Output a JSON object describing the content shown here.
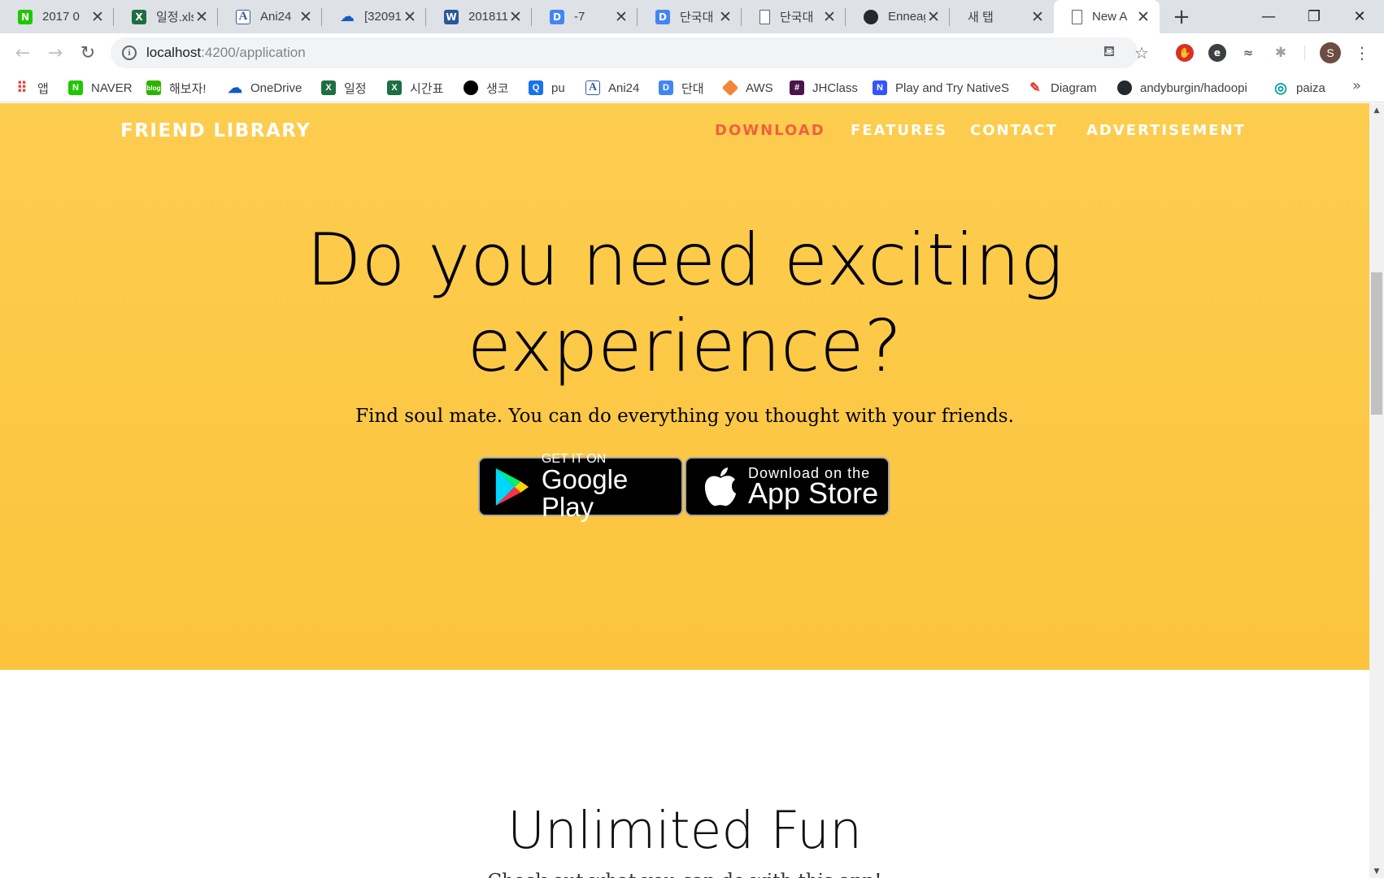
{
  "browser": {
    "tabs": [
      {
        "title": "2017 0",
        "icon": "naver-icon",
        "color": "#1ec800",
        "glyph": "N"
      },
      {
        "title": "일정.xls",
        "icon": "excel-icon",
        "color": "#1d6f42",
        "glyph": "X"
      },
      {
        "title": "Ani24",
        "icon": "ani24-icon",
        "color": "#3a5ba0",
        "glyph": "A"
      },
      {
        "title": "[32091",
        "icon": "onedrive-icon",
        "color": "#0f5bc2",
        "glyph": "☁"
      },
      {
        "title": "201811",
        "icon": "word-icon",
        "color": "#2b579a",
        "glyph": "W"
      },
      {
        "title": "-7",
        "icon": "daum-d-icon",
        "color": "#4285f4",
        "glyph": "D"
      },
      {
        "title": "단국대",
        "icon": "daum-d-icon",
        "color": "#4285f4",
        "glyph": "D"
      },
      {
        "title": "단국대",
        "icon": "document-icon",
        "color": "#ffffff",
        "glyph": ""
      },
      {
        "title": "Enneag",
        "icon": "github-icon",
        "color": "#24292e",
        "glyph": "●"
      },
      {
        "title": "새 탭",
        "icon": "",
        "color": "",
        "glyph": ""
      },
      {
        "title": "New A",
        "icon": "document-icon",
        "color": "#ffffff",
        "glyph": ""
      }
    ],
    "address": {
      "host": "localhost",
      "path": ":4200/application"
    },
    "profile_initial": "S",
    "bookmarks": [
      {
        "label": "앱",
        "icon": "apps-grid-icon",
        "color": "#ea4335",
        "glyph": "⋮"
      },
      {
        "label": "NAVER",
        "icon": "naver-icon",
        "color": "#1ec800",
        "glyph": "N"
      },
      {
        "label": "해보자!",
        "icon": "blog-icon",
        "color": "#2db400",
        "glyph": "b"
      },
      {
        "label": "OneDrive",
        "icon": "onedrive-icon",
        "color": "#0f5bc2",
        "glyph": "☁"
      },
      {
        "label": "일정",
        "icon": "excel-icon",
        "color": "#1d6f42",
        "glyph": "X"
      },
      {
        "label": "시간표",
        "icon": "excel-icon",
        "color": "#1d6f42",
        "glyph": "X"
      },
      {
        "label": "생코",
        "icon": "circle-icon",
        "color": "#000000",
        "glyph": ""
      },
      {
        "label": "pu",
        "icon": "blue-square-icon",
        "color": "#1a73e8",
        "glyph": "Q"
      },
      {
        "label": "Ani24",
        "icon": "ani24-icon",
        "color": "#3a5ba0",
        "glyph": "A"
      },
      {
        "label": "단대",
        "icon": "daum-d-icon",
        "color": "#4285f4",
        "glyph": "D"
      },
      {
        "label": "AWS",
        "icon": "aws-cube-icon",
        "color": "#f58536",
        "glyph": "◆"
      },
      {
        "label": "JHClass",
        "icon": "hash-icon",
        "color": "#4a154b",
        "glyph": "#"
      },
      {
        "label": "Play and Try NativeS",
        "icon": "nativescript-icon",
        "color": "#3655ff",
        "glyph": "N"
      },
      {
        "label": "Diagram",
        "icon": "diagram-icon",
        "color": "#e53935",
        "glyph": "✎"
      },
      {
        "label": "andyburgin/hadoopi",
        "icon": "github-icon",
        "color": "#24292e",
        "glyph": "●"
      },
      {
        "label": "paiza",
        "icon": "paiza-icon",
        "color": "#00a0a0",
        "glyph": "◎"
      }
    ]
  },
  "page": {
    "brand": "FRIEND LIBRARY",
    "nav": [
      {
        "label": "DOWNLOAD",
        "active": true
      },
      {
        "label": "FEATURES",
        "active": false
      },
      {
        "label": "CONTACT",
        "active": false
      },
      {
        "label": "ADVERTISEMENT",
        "active": false
      }
    ],
    "hero": {
      "headline_line1": "Do you need exciting",
      "headline_line2": "experience?",
      "subheadline": "Find soul mate. You can do everything you thought with your friends.",
      "google_play": {
        "small": "GET IT ON",
        "big": "Google Play"
      },
      "app_store": {
        "small": "Download on the",
        "big": "App Store"
      }
    },
    "section2": {
      "title": "Unlimited Fun",
      "subtitle": "Check out what you can do with this app!"
    }
  },
  "colors": {
    "hero_bg": "#fdc94a",
    "nav_active": "#f05f40",
    "nav_default": "#ffffff"
  }
}
